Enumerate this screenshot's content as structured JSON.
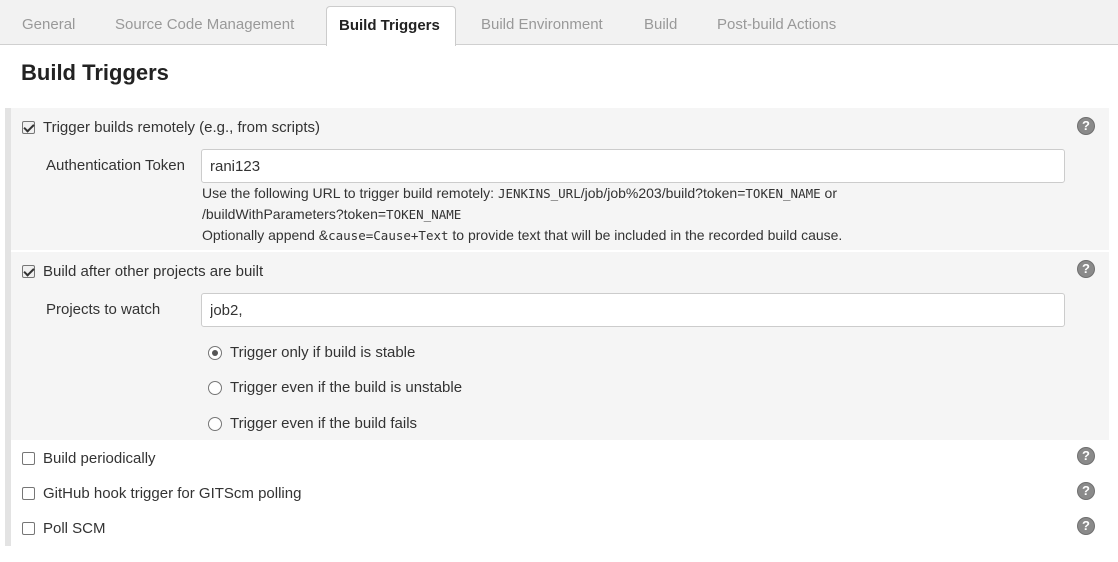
{
  "tabs": [
    {
      "label": "General",
      "active": false
    },
    {
      "label": "Source Code Management",
      "active": false
    },
    {
      "label": "Build Triggers",
      "active": true
    },
    {
      "label": "Build Environment",
      "active": false
    },
    {
      "label": "Build",
      "active": false
    },
    {
      "label": "Post-build Actions",
      "active": false
    }
  ],
  "section_title": "Build Triggers",
  "triggers": {
    "remote": {
      "label": "Trigger builds remotely (e.g., from scripts)",
      "checked": true,
      "token_label": "Authentication Token",
      "token_value": "rani123",
      "help": {
        "line1_prefix": "Use the following URL to trigger build remotely: ",
        "line1_code1": "JENKINS_URL",
        "line1_path": "/job/job%203/build?token=",
        "line1_code2": "TOKEN_NAME",
        "line1_suffix": " or",
        "line2_path": "/buildWithParameters?token=",
        "line2_code": "TOKEN_NAME",
        "line3_prefix": "Optionally append ",
        "line3_amp": "&",
        "line3_code": "cause=Cause+Text",
        "line3_suffix": " to provide text that will be included in the recorded build cause."
      }
    },
    "after_other": {
      "label": "Build after other projects are built",
      "checked": true,
      "projects_label": "Projects to watch",
      "projects_value": "job2,",
      "options": [
        {
          "label": "Trigger only if build is stable",
          "selected": true
        },
        {
          "label": "Trigger even if the build is unstable",
          "selected": false
        },
        {
          "label": "Trigger even if the build fails",
          "selected": false
        }
      ]
    },
    "periodically": {
      "label": "Build periodically",
      "checked": false
    },
    "github_hook": {
      "label": "GitHub hook trigger for GITScm polling",
      "checked": false
    },
    "poll_scm": {
      "label": "Poll SCM",
      "checked": false
    }
  },
  "help_icon_glyph": "?",
  "icons": {
    "help": "help-circle-icon",
    "checkbox": "checkbox",
    "radio": "radio-button"
  },
  "colors": {
    "tab_bar_bg": "#f2f2f2",
    "block_bg": "#f5f5f5",
    "help_icon": "#8a8a8a"
  }
}
